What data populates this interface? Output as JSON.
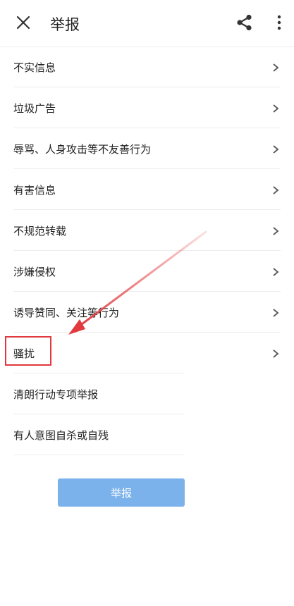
{
  "header": {
    "title": "举报",
    "close_icon": "close-icon",
    "share_icon": "share-icon",
    "more_icon": "more-vertical-icon"
  },
  "reasons": [
    {
      "label": "不实信息",
      "has_chevron": true
    },
    {
      "label": "垃圾广告",
      "has_chevron": true
    },
    {
      "label": "辱骂、人身攻击等不友善行为",
      "has_chevron": true
    },
    {
      "label": "有害信息",
      "has_chevron": true
    },
    {
      "label": "不规范转载",
      "has_chevron": true
    },
    {
      "label": "涉嫌侵权",
      "has_chevron": true
    },
    {
      "label": "诱导赞同、关注等行为",
      "has_chevron": true
    },
    {
      "label": "骚扰",
      "has_chevron": true
    },
    {
      "label": "清朗行动专项举报",
      "has_chevron": false
    },
    {
      "label": "有人意图自杀或自残",
      "has_chevron": false
    }
  ],
  "submit": {
    "label": "举报"
  },
  "annotation": {
    "highlight_color": "#e0393e",
    "arrow_color": "#e0393e"
  },
  "colors": {
    "button_bg": "#7cb2ec"
  }
}
